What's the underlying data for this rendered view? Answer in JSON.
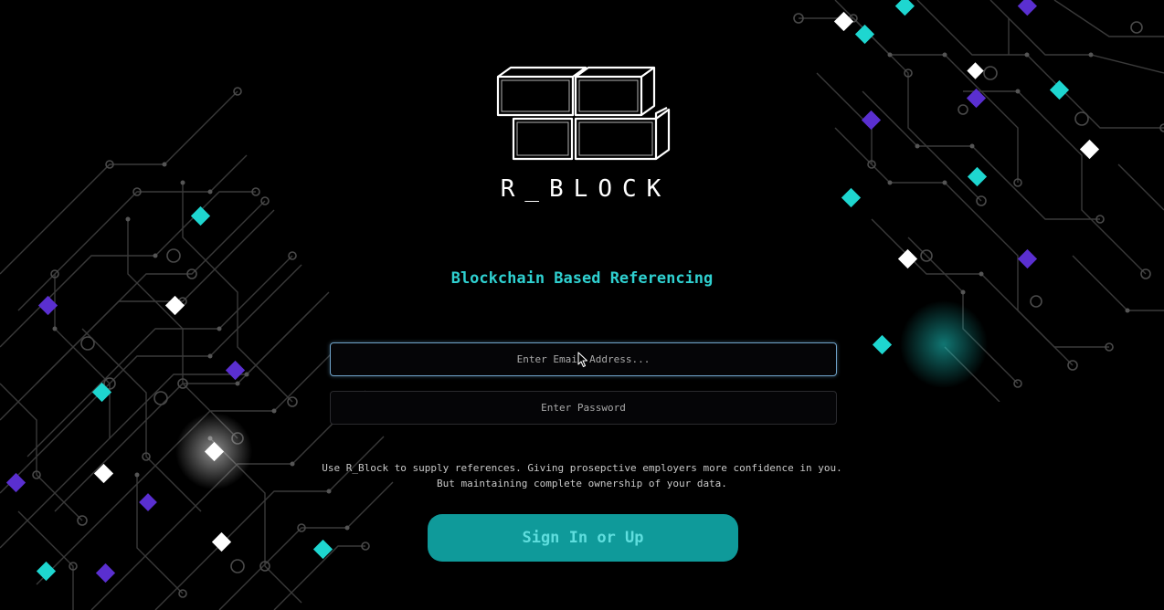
{
  "brand": {
    "name": "R_BLOCK",
    "tagline": "Blockchain Based Referencing"
  },
  "form": {
    "email_placeholder": "Enter Email Address...",
    "password_placeholder": "Enter Password",
    "blurb": "Use R_Block to supply references. Giving prosepctive employers more confidence in you. But maintaining complete ownership of your data.",
    "submit_label": "Sign In or Up"
  },
  "colors": {
    "background": "#000000",
    "accent": "#2fd0d0",
    "button": "#0f9a9a",
    "button_text": "#5fdede",
    "diamond_teal": "#1ed6d0",
    "diamond_purple": "#5a2fd0",
    "diamond_white": "#ffffff"
  },
  "icons": {
    "logo": "stacked-blocks-logo-icon",
    "cursor": "mouse-pointer-icon"
  }
}
